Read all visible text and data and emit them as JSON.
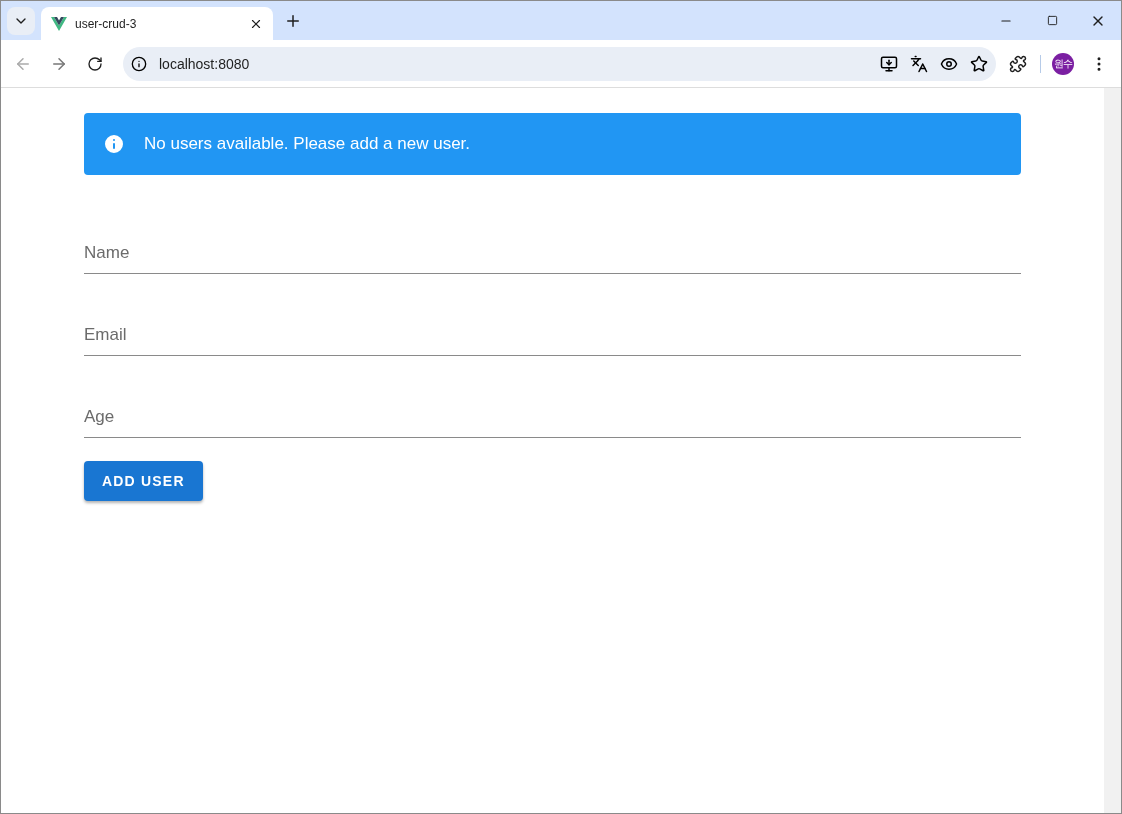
{
  "browser": {
    "tabs": [
      {
        "title": "user-crud-3",
        "selected": true
      }
    ],
    "url": "localhost:8080",
    "profile": "원수"
  },
  "alert": {
    "message": "No users available. Please add a new user."
  },
  "form": {
    "fields": [
      {
        "placeholder": "Name"
      },
      {
        "placeholder": "Email"
      },
      {
        "placeholder": "Age"
      }
    ],
    "button": "ADD USER"
  }
}
